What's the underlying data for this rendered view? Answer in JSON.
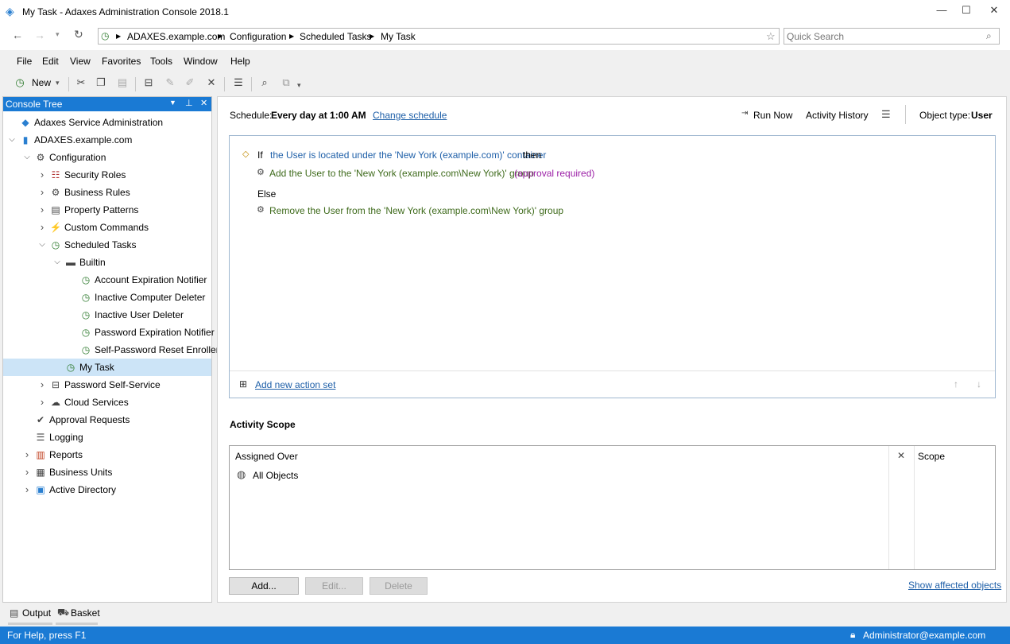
{
  "window": {
    "title": "My Task - Adaxes Administration Console 2018.1"
  },
  "nav": {
    "breadcrumb": [
      "ADAXES.example.com",
      "Configuration",
      "Scheduled Tasks",
      "My Task"
    ],
    "search_placeholder": "Quick Search"
  },
  "menu": [
    "File",
    "Edit",
    "View",
    "Favorites",
    "Tools",
    "Window",
    "Help"
  ],
  "toolbar": {
    "new_label": "New"
  },
  "tree": {
    "header": "Console Tree",
    "nodes": [
      {
        "label": "Adaxes Service Administration",
        "icon": "service-admin-icon"
      },
      {
        "label": "ADAXES.example.com",
        "icon": "server-icon"
      },
      {
        "label": "Configuration",
        "icon": "configuration-icon"
      },
      {
        "label": "Security Roles",
        "icon": "security-roles-icon"
      },
      {
        "label": "Business Rules",
        "icon": "business-rules-icon"
      },
      {
        "label": "Property Patterns",
        "icon": "property-patterns-icon"
      },
      {
        "label": "Custom Commands",
        "icon": "custom-commands-icon"
      },
      {
        "label": "Scheduled Tasks",
        "icon": "clock-icon"
      },
      {
        "label": "Builtin",
        "icon": "folder-icon"
      },
      {
        "label": "Account Expiration Notifier",
        "icon": "scheduled-task-icon"
      },
      {
        "label": "Inactive Computer Deleter",
        "icon": "scheduled-task-icon"
      },
      {
        "label": "Inactive User Deleter",
        "icon": "scheduled-task-icon"
      },
      {
        "label": "Password Expiration Notifier",
        "icon": "scheduled-task-icon"
      },
      {
        "label": "Self-Password Reset Enroller",
        "icon": "scheduled-task-icon"
      },
      {
        "label": "My Task",
        "icon": "scheduled-task-icon"
      },
      {
        "label": "Password Self-Service",
        "icon": "password-self-service-icon"
      },
      {
        "label": "Cloud Services",
        "icon": "cloud-icon"
      },
      {
        "label": "Approval Requests",
        "icon": "approval-icon"
      },
      {
        "label": "Logging",
        "icon": "logging-icon"
      },
      {
        "label": "Reports",
        "icon": "reports-icon"
      },
      {
        "label": "Business Units",
        "icon": "business-units-icon"
      },
      {
        "label": "Active Directory",
        "icon": "active-directory-icon"
      }
    ]
  },
  "schedule": {
    "label": "Schedule:",
    "value": "Every day at 1:00 AM",
    "change_link": "Change schedule",
    "run_now": "Run Now",
    "activity_history": "Activity History",
    "object_type_label": "Object type:",
    "object_type_value": "User"
  },
  "rule": {
    "if_keyword": "If",
    "condition": "the User is located under the 'New York (example.com)' container",
    "then_keyword": "then",
    "action1": "Add the User to the 'New York (example.com\\New York)' group",
    "action1_note": "(approval required)",
    "else_keyword": "Else",
    "action2": "Remove the User from the 'New York (example.com\\New York)' group",
    "add_action_set": "Add new action set"
  },
  "scope": {
    "title": "Activity Scope",
    "col_assigned": "Assigned Over",
    "col_scope": "Scope",
    "rows": [
      "All Objects"
    ],
    "add_btn": "Add...",
    "edit_btn": "Edit...",
    "delete_btn": "Delete",
    "show_affected": "Show affected objects"
  },
  "bottom_tabs": [
    "Output",
    "Basket"
  ],
  "status": {
    "help": "For Help, press F1",
    "user": "Administrator@example.com"
  },
  "colors": {
    "accent": "#1a7ad4",
    "link": "#1e5fa8",
    "approval": "#9b1fa6",
    "action": "#3f6b1c"
  }
}
